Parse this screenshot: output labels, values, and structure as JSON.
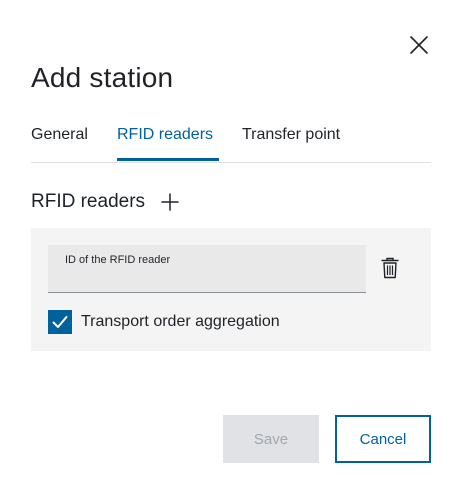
{
  "dialog": {
    "title": "Add station",
    "close_icon": "close-icon"
  },
  "tabs": [
    {
      "label": "General",
      "active": false
    },
    {
      "label": "RFID readers",
      "active": true
    },
    {
      "label": "Transfer point",
      "active": false
    }
  ],
  "rfid_section": {
    "title": "RFID readers",
    "add_icon": "plus-icon",
    "reader": {
      "input_label": "ID of the RFID reader",
      "input_value": "",
      "delete_icon": "trash-icon"
    },
    "checkbox": {
      "label": "Transport order aggregation",
      "checked": true
    }
  },
  "footer": {
    "save_label": "Save",
    "save_enabled": false,
    "cancel_label": "Cancel"
  },
  "colors": {
    "accent": "#00629a",
    "panel_bg": "#f4f4f5",
    "input_bg": "#e9e9ea",
    "disabled_bg": "#e0e2e5",
    "disabled_text": "#a1a7ad",
    "text": "#1f2328"
  }
}
